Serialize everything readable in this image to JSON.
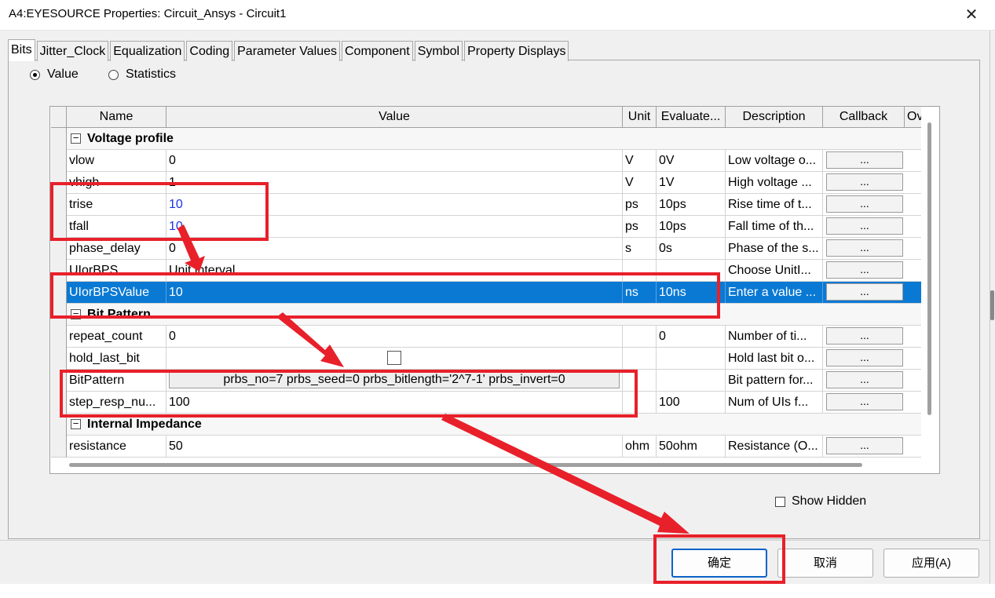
{
  "window": {
    "title": "A4:EYESOURCE Properties: Circuit_Ansys - Circuit1",
    "close_glyph": "✕"
  },
  "tabs": [
    {
      "label": "Bits",
      "active": true
    },
    {
      "label": "Jitter_Clock",
      "active": false
    },
    {
      "label": "Equalization",
      "active": false
    },
    {
      "label": "Coding",
      "active": false
    },
    {
      "label": "Parameter Values",
      "active": false
    },
    {
      "label": "Component",
      "active": false
    },
    {
      "label": "Symbol",
      "active": false
    },
    {
      "label": "Property Displays",
      "active": false
    }
  ],
  "mode": {
    "value_label": "Value",
    "statistics_label": "Statistics",
    "selected": "Value"
  },
  "grid": {
    "columns": {
      "name": "Name",
      "value": "Value",
      "unit": "Unit",
      "evaluated": "Evaluate...",
      "description": "Description",
      "callback": "Callback",
      "overflow": "Ov"
    },
    "callback_label": "...",
    "groups": {
      "voltage": {
        "label": "Voltage profile",
        "toggle": "−"
      },
      "bitpattern": {
        "label": "Bit Pattern",
        "toggle": "−"
      },
      "impedance": {
        "label": "Internal Impedance",
        "toggle": "−"
      }
    },
    "rows": {
      "vlow": {
        "name": "vlow",
        "value": "0",
        "unit": "V",
        "evaluated": "0V",
        "description": "Low voltage o..."
      },
      "vhigh": {
        "name": "vhigh",
        "value": "1",
        "unit": "V",
        "evaluated": "1V",
        "description": "High voltage ..."
      },
      "trise": {
        "name": "trise",
        "value": "10",
        "unit": "ps",
        "evaluated": "10ps",
        "description": "Rise time of t..."
      },
      "tfall": {
        "name": "tfall",
        "value": "10",
        "unit": "ps",
        "evaluated": "10ps",
        "description": "Fall time of th..."
      },
      "phase_delay": {
        "name": "phase_delay",
        "value": "0",
        "unit": "s",
        "evaluated": "0s",
        "description": "Phase of the s..."
      },
      "uiorbps": {
        "name": "UIorBPS",
        "value": "Unit interval",
        "unit": "",
        "evaluated": "",
        "description": "Choose UnitI..."
      },
      "uiorbpsvalue": {
        "name": "UIorBPSValue",
        "value": "10",
        "unit": "ns",
        "evaluated": "10ns",
        "description": "Enter a value ..."
      },
      "repeat_count": {
        "name": "repeat_count",
        "value": "0",
        "unit": "",
        "evaluated": "0",
        "description": "Number of ti..."
      },
      "hold_last_bit": {
        "name": "hold_last_bit",
        "value": "",
        "unit": "",
        "evaluated": "",
        "description": "Hold last bit o..."
      },
      "bitpattern": {
        "name": "BitPattern",
        "value": "prbs_no=7 prbs_seed=0 prbs_bitlength='2^7-1' prbs_invert=0",
        "unit": "",
        "evaluated": "",
        "description": "Bit pattern for..."
      },
      "step_resp": {
        "name": "step_resp_nu...",
        "value": "100",
        "unit": "",
        "evaluated": "100",
        "description": "Num of UIs f..."
      },
      "resistance": {
        "name": "resistance",
        "value": "50",
        "unit": "ohm",
        "evaluated": "50ohm",
        "description": "Resistance (O..."
      }
    }
  },
  "show_hidden": {
    "label": "Show Hidden",
    "checked": false
  },
  "buttons": {
    "ok": "确定",
    "cancel": "取消",
    "apply": "应用(A)"
  },
  "colors": {
    "selection": "#0a79d4",
    "annotation": "#e8202a",
    "link_value": "#1a33e6"
  }
}
